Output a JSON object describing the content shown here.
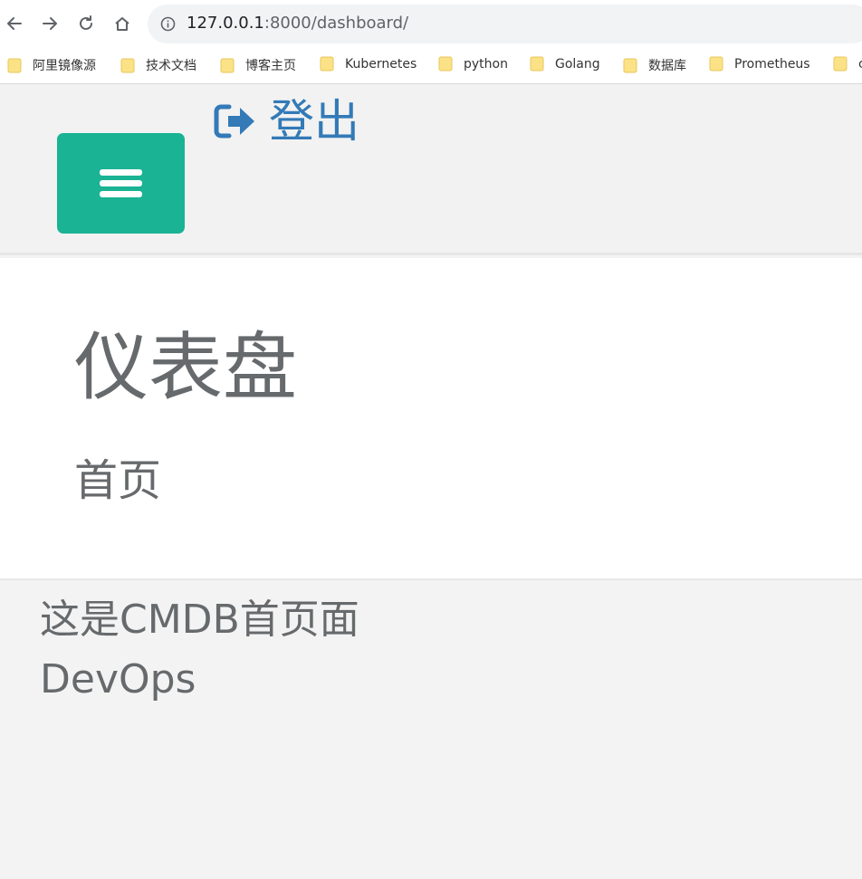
{
  "browser": {
    "url_host": "127.0.0.1",
    "url_rest": ":8000/dashboard/",
    "nav_icons": [
      "back-arrow-icon",
      "forward-arrow-icon",
      "reload-icon",
      "home-icon",
      "info-icon"
    ],
    "bookmarks": [
      {
        "label": "阿里镜像源"
      },
      {
        "label": "技术文档"
      },
      {
        "label": "博客主页"
      },
      {
        "label": "Kubernetes"
      },
      {
        "label": "python"
      },
      {
        "label": "Golang"
      },
      {
        "label": "数据库"
      },
      {
        "label": "Prometheus"
      },
      {
        "label": "c"
      }
    ]
  },
  "header": {
    "menu_icon": "hamburger-icon",
    "logout_icon": "sign-out-icon",
    "logout_label": "登出"
  },
  "breadcrumb_panel": {
    "title": "仪表盘",
    "crumb": "首页"
  },
  "content": {
    "line1": "这是CMDB首页面",
    "line2": "DevOps"
  },
  "colors": {
    "accent_green": "#1ab394",
    "link_blue": "#337ab7",
    "text_gray": "#676a6c"
  }
}
